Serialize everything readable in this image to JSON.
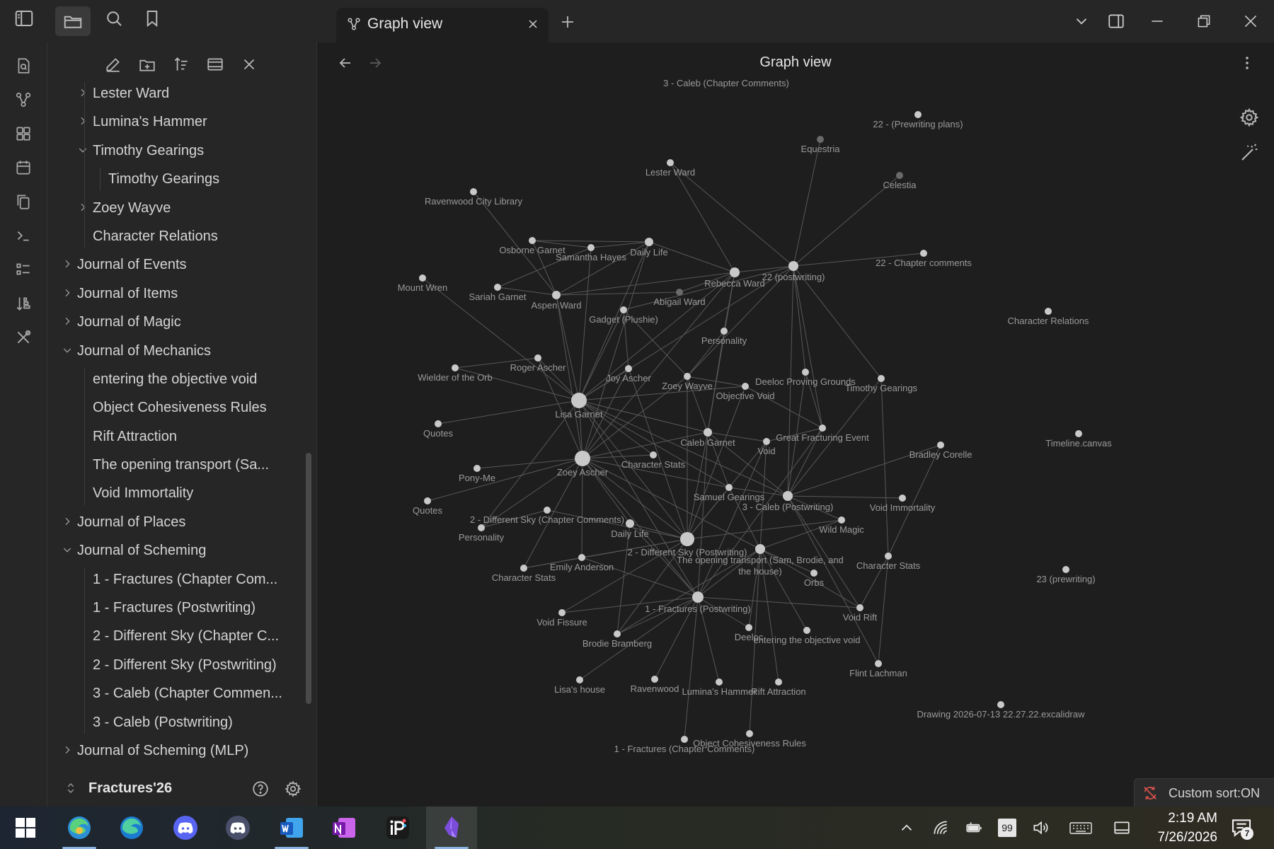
{
  "tab": {
    "title": "Graph view"
  },
  "sidebar": {
    "items": [
      {
        "label": "Lester Ward",
        "depth": 1,
        "chevron": "right"
      },
      {
        "label": "Lumina's Hammer",
        "depth": 1,
        "chevron": "right"
      },
      {
        "label": "Timothy Gearings",
        "depth": 1,
        "chevron": "down"
      },
      {
        "label": "Timothy Gearings",
        "depth": 2,
        "chevron": null
      },
      {
        "label": "Zoey Wayve",
        "depth": 1,
        "chevron": "right"
      },
      {
        "label": "Character Relations",
        "depth": 1,
        "chevron": null
      },
      {
        "label": "Journal of Events",
        "depth": 0,
        "chevron": "right"
      },
      {
        "label": "Journal of Items",
        "depth": 0,
        "chevron": "right"
      },
      {
        "label": "Journal of Magic",
        "depth": 0,
        "chevron": "right"
      },
      {
        "label": "Journal of Mechanics",
        "depth": 0,
        "chevron": "down"
      },
      {
        "label": "entering the objective void",
        "depth": 1,
        "chevron": null
      },
      {
        "label": "Object Cohesiveness Rules",
        "depth": 1,
        "chevron": null
      },
      {
        "label": "Rift Attraction",
        "depth": 1,
        "chevron": null
      },
      {
        "label": "The opening transport (Sa...",
        "depth": 1,
        "chevron": null
      },
      {
        "label": "Void Immortality",
        "depth": 1,
        "chevron": null
      },
      {
        "label": "Journal of Places",
        "depth": 0,
        "chevron": "right"
      },
      {
        "label": "Journal of Scheming",
        "depth": 0,
        "chevron": "down"
      },
      {
        "label": "1 - Fractures (Chapter Com...",
        "depth": 1,
        "chevron": null
      },
      {
        "label": "1 - Fractures (Postwriting)",
        "depth": 1,
        "chevron": null
      },
      {
        "label": "2 - Different Sky (Chapter C...",
        "depth": 1,
        "chevron": null
      },
      {
        "label": "2 - Different Sky (Postwriting)",
        "depth": 1,
        "chevron": null
      },
      {
        "label": "3 - Caleb (Chapter Commen...",
        "depth": 1,
        "chevron": null
      },
      {
        "label": "3 - Caleb (Postwriting)",
        "depth": 1,
        "chevron": null
      },
      {
        "label": "Journal of Scheming (MLP)",
        "depth": 0,
        "chevron": "right"
      }
    ],
    "vault_name": "Fractures'26"
  },
  "main": {
    "title": "Graph view"
  },
  "status": {
    "sort_label": "Custom sort:ON"
  },
  "taskbar": {
    "time": "2:19 AM",
    "date": "7/26/2026",
    "notification_count": "7",
    "keyboard_badge": "99",
    "apps": [
      "windows-start",
      "edge-canary",
      "edge",
      "discord",
      "discord-alt",
      "word",
      "onenote",
      "ibis-paint",
      "obsidian"
    ]
  },
  "colors": {
    "background": "#1e1e1e",
    "panel": "#262626",
    "graph_node": "#c9c9c9",
    "graph_node_dim": "#6a6a6a",
    "graph_edge": "#585858",
    "graph_label": "#9a9a9a",
    "sort_icon": "#d9534f"
  },
  "graph": {
    "nodes": [
      {
        "id": "caleb-cc",
        "label": "3 - Caleb (Chapter Comments)",
        "size": 0
      },
      {
        "id": "prewriting-plans",
        "label": "22 - (Prewriting plans)",
        "size": 5
      },
      {
        "id": "equestria",
        "label": "Equestria",
        "size": 5,
        "dim": true
      },
      {
        "id": "lester",
        "label": "Lester Ward",
        "size": 5
      },
      {
        "id": "celestia",
        "label": "Celestia",
        "size": 5,
        "dim": true
      },
      {
        "id": "ravenwood-lib",
        "label": "Ravenwood City Library",
        "size": 5
      },
      {
        "id": "osborne",
        "label": "Osborne Garnet",
        "size": 5
      },
      {
        "id": "samantha",
        "label": "Samantha Hayes",
        "size": 5
      },
      {
        "id": "daily-life-1",
        "label": "Daily Life",
        "size": 6
      },
      {
        "id": "rebecca",
        "label": "Rebecca Ward",
        "size": 7
      },
      {
        "id": "postwriting-22",
        "label": "22 (postwriting)",
        "size": 7
      },
      {
        "id": "chapter-comments-22",
        "label": "22 - Chapter comments",
        "size": 5
      },
      {
        "id": "mount-wren",
        "label": "Mount Wren",
        "size": 5
      },
      {
        "id": "sariah",
        "label": "Sariah Garnet",
        "size": 5
      },
      {
        "id": "aspen",
        "label": "Aspen Ward",
        "size": 6
      },
      {
        "id": "abigail",
        "label": "Abigail Ward",
        "size": 5,
        "dim": true
      },
      {
        "id": "gadget",
        "label": "Gadget (Plushie)",
        "size": 5
      },
      {
        "id": "char-relations",
        "label": "Character Relations",
        "size": 5
      },
      {
        "id": "personality-1",
        "label": "Personality",
        "size": 5
      },
      {
        "id": "wielder",
        "label": "Wielder of the Orb",
        "size": 5
      },
      {
        "id": "roger",
        "label": "Roger Ascher",
        "size": 5
      },
      {
        "id": "joy",
        "label": "Joy Ascher",
        "size": 5
      },
      {
        "id": "zoey-wayve",
        "label": "Zoey Wayve",
        "size": 5
      },
      {
        "id": "deeloc-grounds",
        "label": "Deeloc Proving Grounds",
        "size": 5
      },
      {
        "id": "objective-void",
        "label": "Objective Void",
        "size": 5
      },
      {
        "id": "timothy",
        "label": "Timothy Gearings",
        "size": 5
      },
      {
        "id": "lisa",
        "label": "Lisa Garnet",
        "size": 11
      },
      {
        "id": "quotes-1",
        "label": "Quotes",
        "size": 5
      },
      {
        "id": "caleb-garnet",
        "label": "Caleb Garnet",
        "size": 6
      },
      {
        "id": "great-fracturing",
        "label": "Great Fracturing Event",
        "size": 5
      },
      {
        "id": "void",
        "label": "Void",
        "size": 5
      },
      {
        "id": "timeline",
        "label": "Timeline.canvas",
        "size": 5
      },
      {
        "id": "bradley",
        "label": "Bradley Corelle",
        "size": 5
      },
      {
        "id": "zoey-ascher",
        "label": "Zoey Ascher",
        "size": 11
      },
      {
        "id": "char-stats-1",
        "label": "Character Stats",
        "size": 5
      },
      {
        "id": "pony-me",
        "label": "Pony-Me",
        "size": 5
      },
      {
        "id": "samuel",
        "label": "Samuel Gearings",
        "size": 5
      },
      {
        "id": "caleb-pw",
        "label": "3 - Caleb (Postwriting)",
        "size": 7
      },
      {
        "id": "void-immortality",
        "label": "Void Immortality",
        "size": 5
      },
      {
        "id": "quotes-2",
        "label": "Quotes",
        "size": 5
      },
      {
        "id": "diff-sky-cc",
        "label": "2 - Different Sky (Chapter Comments)",
        "size": 5
      },
      {
        "id": "personality-2",
        "label": "Personality",
        "size": 5
      },
      {
        "id": "daily-life-2",
        "label": "Daily Life",
        "size": 6
      },
      {
        "id": "wild-magic",
        "label": "Wild Magic",
        "size": 5
      },
      {
        "id": "diff-sky-pw",
        "label": "2 - Different Sky (Postwriting)",
        "size": 10
      },
      {
        "id": "opening-transport",
        "label": "The opening transport (Sam, Brodie, and the house)",
        "size": 7
      },
      {
        "id": "emily",
        "label": "Emily Anderson",
        "size": 5
      },
      {
        "id": "char-stats-2",
        "label": "Character Stats",
        "size": 5
      },
      {
        "id": "orbs",
        "label": "Orbs",
        "size": 5
      },
      {
        "id": "char-stats-3",
        "label": "Character Stats",
        "size": 5
      },
      {
        "id": "prewriting-23",
        "label": "23 (prewriting)",
        "size": 5
      },
      {
        "id": "fractures-pw",
        "label": "1 - Fractures (Postwriting)",
        "size": 8
      },
      {
        "id": "void-fissure",
        "label": "Void Fissure",
        "size": 5
      },
      {
        "id": "void-rift",
        "label": "Void Rift",
        "size": 5
      },
      {
        "id": "brodie",
        "label": "Brodie Bramberg",
        "size": 5
      },
      {
        "id": "deeloc",
        "label": "Deeloc",
        "size": 5
      },
      {
        "id": "entering-void",
        "label": "entering the objective void",
        "size": 5
      },
      {
        "id": "flint",
        "label": "Flint Lachman",
        "size": 5
      },
      {
        "id": "lisas-house",
        "label": "Lisa's house",
        "size": 5
      },
      {
        "id": "ravenwood",
        "label": "Ravenwood",
        "size": 5
      },
      {
        "id": "luminas-hammer",
        "label": "Lumina's Hammer",
        "size": 5
      },
      {
        "id": "rift-attraction",
        "label": "Rift Attraction",
        "size": 5
      },
      {
        "id": "drawing",
        "label": "Drawing 2026-07-13 22.27.22.excalidraw",
        "size": 5
      },
      {
        "id": "object-cohesiveness",
        "label": "Object Cohesiveness Rules",
        "size": 5
      },
      {
        "id": "fractures-cc",
        "label": "1 - Fractures (Chapter Comments)",
        "size": 5
      }
    ],
    "edges": [
      [
        "postwriting-22",
        "chapter-comments-22"
      ],
      [
        "postwriting-22",
        "equestria"
      ],
      [
        "postwriting-22",
        "rebecca"
      ],
      [
        "postwriting-22",
        "lester"
      ],
      [
        "postwriting-22",
        "celestia"
      ],
      [
        "postwriting-22",
        "timothy"
      ],
      [
        "postwriting-22",
        "deeloc-grounds"
      ],
      [
        "postwriting-22",
        "caleb-pw"
      ],
      [
        "postwriting-22",
        "great-fracturing"
      ],
      [
        "postwriting-22",
        "gadget"
      ],
      [
        "postwriting-22",
        "zoey-wayve"
      ],
      [
        "postwriting-22",
        "lisa"
      ],
      [
        "rebecca",
        "aspen"
      ],
      [
        "rebecca",
        "daily-life-1"
      ],
      [
        "rebecca",
        "lester"
      ],
      [
        "rebecca",
        "personality-1"
      ],
      [
        "rebecca",
        "lisa"
      ],
      [
        "rebecca",
        "zoey-ascher"
      ],
      [
        "rebecca",
        "caleb-garnet"
      ],
      [
        "rebecca",
        "abigail"
      ],
      [
        "daily-life-1",
        "osborne"
      ],
      [
        "daily-life-1",
        "samantha"
      ],
      [
        "daily-life-1",
        "lisa"
      ],
      [
        "daily-life-1",
        "zoey-ascher"
      ],
      [
        "daily-life-1",
        "aspen"
      ],
      [
        "samantha",
        "osborne"
      ],
      [
        "samantha",
        "sariah"
      ],
      [
        "samantha",
        "lisa"
      ],
      [
        "aspen",
        "sariah"
      ],
      [
        "aspen",
        "abigail"
      ],
      [
        "aspen",
        "lisa"
      ],
      [
        "aspen",
        "ravenwood-lib"
      ],
      [
        "aspen",
        "osborne"
      ],
      [
        "aspen",
        "zoey-ascher"
      ],
      [
        "lisa",
        "wielder"
      ],
      [
        "lisa",
        "quotes-1"
      ],
      [
        "lisa",
        "roger"
      ],
      [
        "lisa",
        "joy"
      ],
      [
        "lisa",
        "gadget"
      ],
      [
        "lisa",
        "mount-wren"
      ],
      [
        "lisa",
        "caleb-garnet"
      ],
      [
        "lisa",
        "char-stats-1"
      ],
      [
        "lisa",
        "zoey-ascher"
      ],
      [
        "lisa",
        "diff-sky-pw"
      ],
      [
        "lisa",
        "fractures-pw"
      ],
      [
        "lisa",
        "personality-2"
      ],
      [
        "lisa",
        "samuel"
      ],
      [
        "lisa",
        "objective-void"
      ],
      [
        "lisa",
        "caleb-pw"
      ],
      [
        "zoey-ascher",
        "pony-me"
      ],
      [
        "zoey-ascher",
        "quotes-2"
      ],
      [
        "zoey-ascher",
        "joy"
      ],
      [
        "zoey-ascher",
        "roger"
      ],
      [
        "zoey-ascher",
        "char-stats-1"
      ],
      [
        "zoey-ascher",
        "diff-sky-pw"
      ],
      [
        "zoey-ascher",
        "fractures-pw"
      ],
      [
        "zoey-ascher",
        "daily-life-2"
      ],
      [
        "zoey-ascher",
        "zoey-wayve"
      ],
      [
        "zoey-ascher",
        "emily"
      ],
      [
        "zoey-ascher",
        "caleb-garnet"
      ],
      [
        "zoey-ascher",
        "samuel"
      ],
      [
        "zoey-ascher",
        "opening-transport"
      ],
      [
        "zoey-ascher",
        "char-stats-2"
      ],
      [
        "zoey-ascher",
        "personality-2"
      ],
      [
        "diff-sky-pw",
        "daily-life-2"
      ],
      [
        "diff-sky-pw",
        "emily"
      ],
      [
        "diff-sky-pw",
        "samuel"
      ],
      [
        "diff-sky-pw",
        "caleb-garnet"
      ],
      [
        "diff-sky-pw",
        "void"
      ],
      [
        "diff-sky-pw",
        "wild-magic"
      ],
      [
        "diff-sky-pw",
        "char-stats-2"
      ],
      [
        "diff-sky-pw",
        "diff-sky-cc"
      ],
      [
        "diff-sky-pw",
        "brodie"
      ],
      [
        "diff-sky-pw",
        "void-fissure"
      ],
      [
        "diff-sky-pw",
        "zoey-wayve"
      ],
      [
        "diff-sky-pw",
        "objective-void"
      ],
      [
        "diff-sky-pw",
        "joy"
      ],
      [
        "fractures-pw",
        "brodie"
      ],
      [
        "fractures-pw",
        "lisas-house"
      ],
      [
        "fractures-pw",
        "ravenwood"
      ],
      [
        "fractures-pw",
        "luminas-hammer"
      ],
      [
        "fractures-pw",
        "deeloc"
      ],
      [
        "fractures-pw",
        "void-rift"
      ],
      [
        "fractures-pw",
        "fractures-cc"
      ],
      [
        "fractures-pw",
        "void-fissure"
      ],
      [
        "fractures-pw",
        "emily"
      ],
      [
        "fractures-pw",
        "opening-transport"
      ],
      [
        "fractures-pw",
        "great-fracturing"
      ],
      [
        "fractures-pw",
        "caleb-garnet"
      ],
      [
        "fractures-pw",
        "daily-life-2"
      ],
      [
        "fractures-pw",
        "void"
      ],
      [
        "opening-transport",
        "orbs"
      ],
      [
        "opening-transport",
        "void-rift"
      ],
      [
        "opening-transport",
        "entering-void"
      ],
      [
        "opening-transport",
        "rift-attraction"
      ],
      [
        "opening-transport",
        "object-cohesiveness"
      ],
      [
        "opening-transport",
        "deeloc"
      ],
      [
        "opening-transport",
        "samuel"
      ],
      [
        "opening-transport",
        "brodie"
      ],
      [
        "opening-transport",
        "wild-magic"
      ],
      [
        "opening-transport",
        "void"
      ],
      [
        "caleb-pw",
        "wild-magic"
      ],
      [
        "caleb-pw",
        "void-immortality"
      ],
      [
        "caleb-pw",
        "samuel"
      ],
      [
        "caleb-pw",
        "caleb-garnet"
      ],
      [
        "caleb-pw",
        "bradley"
      ],
      [
        "caleb-pw",
        "timothy"
      ],
      [
        "caleb-pw",
        "great-fracturing"
      ],
      [
        "caleb-pw",
        "deeloc-grounds"
      ],
      [
        "caleb-pw",
        "flint"
      ],
      [
        "caleb-pw",
        "void-rift"
      ],
      [
        "char-stats-3",
        "bradley"
      ],
      [
        "char-stats-3",
        "timothy"
      ],
      [
        "char-stats-3",
        "flint"
      ],
      [
        "char-stats-3",
        "void-rift"
      ],
      [
        "caleb-garnet",
        "personality-1"
      ],
      [
        "caleb-garnet",
        "zoey-wayve"
      ],
      [
        "caleb-garnet",
        "void"
      ],
      [
        "caleb-garnet",
        "samuel"
      ],
      [
        "zoey-wayve",
        "objective-void"
      ],
      [
        "zoey-wayve",
        "gadget"
      ],
      [
        "zoey-wayve",
        "personality-1"
      ],
      [
        "great-fracturing",
        "void"
      ],
      [
        "great-fracturing",
        "deeloc-grounds"
      ],
      [
        "great-fracturing",
        "objective-void"
      ],
      [
        "emily",
        "char-stats-2"
      ],
      [
        "roger",
        "wielder"
      ],
      [
        "joy",
        "gadget"
      ],
      [
        "daily-life-2",
        "brodie"
      ],
      [
        "diff-sky-cc",
        "personality-2"
      ]
    ]
  }
}
